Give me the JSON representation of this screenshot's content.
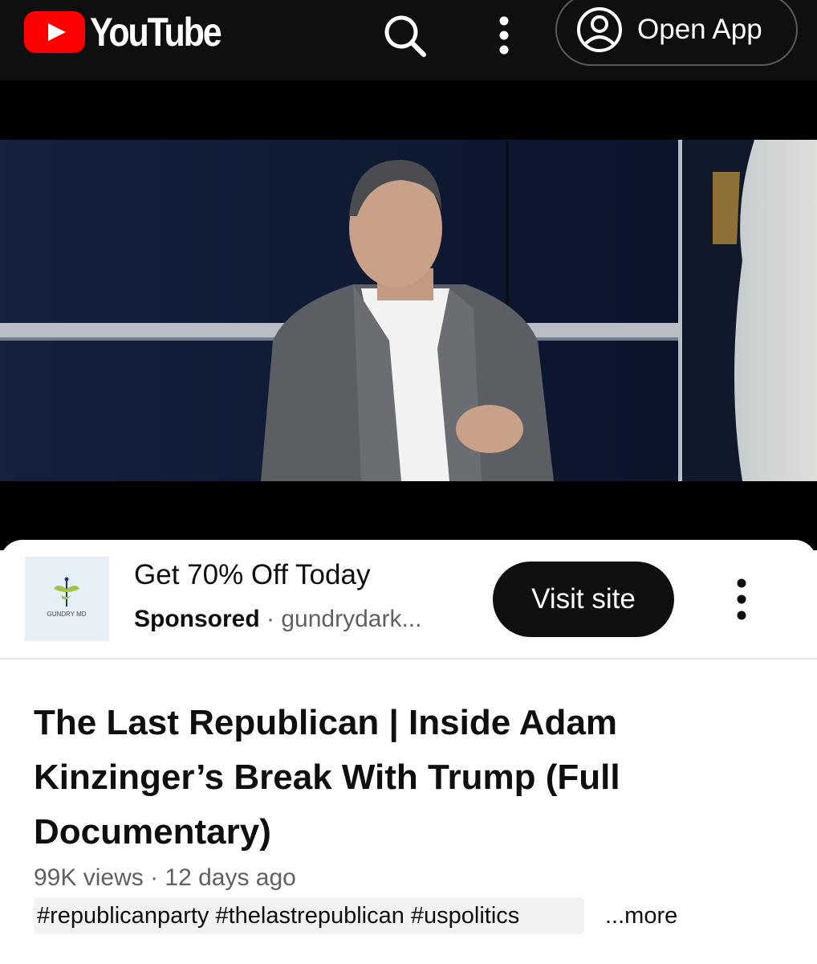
{
  "header": {
    "logo_text": "YouTube",
    "open_app_label": "Open App",
    "icons": [
      "youtube-logo-icon",
      "search-icon",
      "more-vert-icon",
      "account-icon"
    ]
  },
  "ad": {
    "logo_text": "GUNDRY MD",
    "title": "Get 70% Off Today",
    "sponsored_label": "Sponsored",
    "separator": "·",
    "domain": "gundrydark...",
    "cta_label": "Visit site",
    "more_icon": "more-vert-icon"
  },
  "video": {
    "title": "The Last Republican | Inside Adam Kinzinger’s Break With Trump (Full Documentary)",
    "meta": "99K views · 12 days ago",
    "hashtags": "#republicanparty #thelastrepublican #uspolitics",
    "more_label": "...more"
  },
  "colors": {
    "topbar_bg": "#0f0f0f",
    "brand_red": "#ff0000",
    "cta_bg": "#0f0f0f",
    "text_primary": "#0f0f0f",
    "text_secondary": "#606060"
  }
}
